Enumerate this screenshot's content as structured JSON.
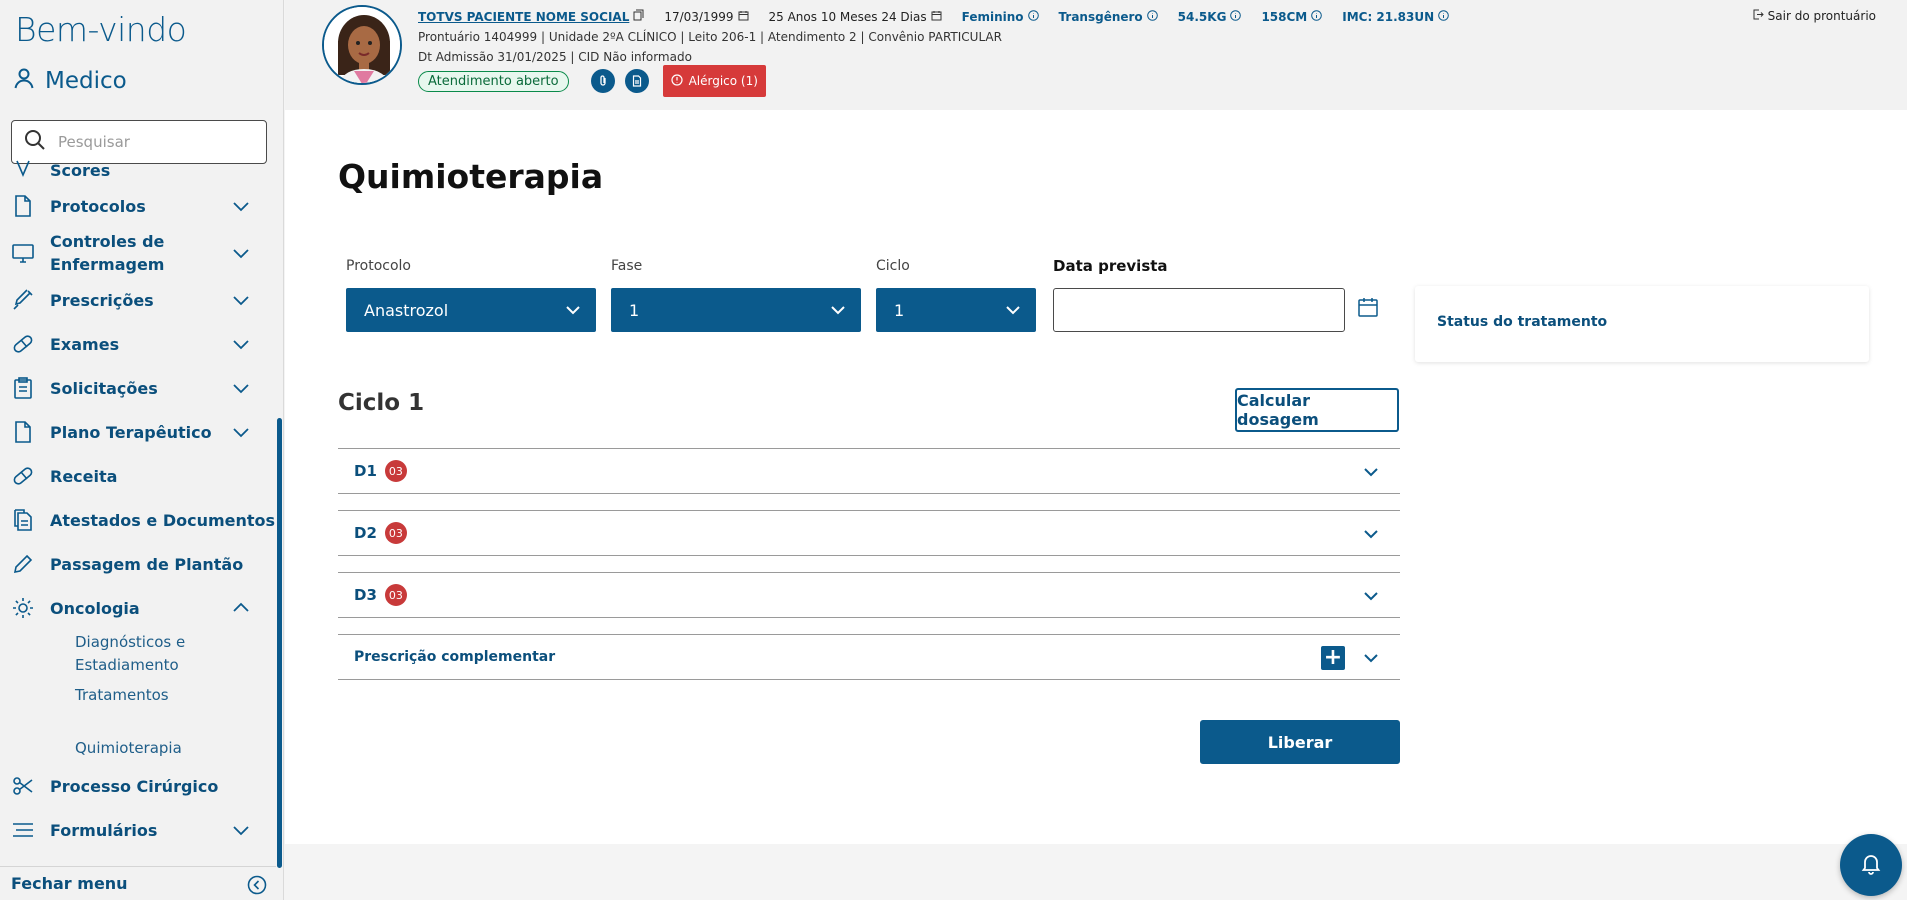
{
  "sidebar": {
    "welcome": "Bem-vindo",
    "user": "Medico",
    "search_placeholder": "Pesquisar",
    "items": [
      {
        "label": "Scores",
        "icon": "scores-icon",
        "expandable": false
      },
      {
        "label": "Protocolos",
        "icon": "document-icon",
        "expandable": true
      },
      {
        "label": "Controles de Enfermagem",
        "icon": "monitor-icon",
        "expandable": true
      },
      {
        "label": "Prescrições",
        "icon": "syringe-icon",
        "expandable": true
      },
      {
        "label": "Exames",
        "icon": "pill-icon",
        "expandable": true
      },
      {
        "label": "Solicitações",
        "icon": "clipboard-icon",
        "expandable": true
      },
      {
        "label": "Plano Terapêutico",
        "icon": "document-icon",
        "expandable": true
      },
      {
        "label": "Receita",
        "icon": "pill-icon",
        "expandable": false
      },
      {
        "label": "Atestados e Documentos",
        "icon": "documents-icon",
        "expandable": false
      },
      {
        "label": "Passagem de Plantão",
        "icon": "pencil-icon",
        "expandable": false
      },
      {
        "label": "Oncologia",
        "icon": "gear-icon",
        "expandable": true,
        "expanded": true
      },
      {
        "label": "Processo Cirúrgico",
        "icon": "scissors-icon",
        "expandable": false
      },
      {
        "label": "Formulários",
        "icon": "list-icon",
        "expandable": true
      }
    ],
    "oncologia_sub": [
      "Diagnósticos e Estadiamento",
      "Tratamentos",
      "Quimioterapia"
    ],
    "close_menu": "Fechar menu"
  },
  "patient": {
    "name": "TOTVS PACIENTE NOME SOCIAL",
    "birth": "17/03/1999",
    "age": "25 Anos 10 Meses 24 Dias",
    "sex": "Feminino",
    "gender": "Transgênero",
    "weight": "54.5KG",
    "height": "158CM",
    "imc": "IMC: 21.83UN",
    "line2": "Prontuário 1404999  |  Unidade 2ºA CLÍNICO  |  Leito 206-1  |  Atendimento 2  |  Convênio PARTICULAR",
    "line3": "Dt Admissão 31/01/2025  |  CID Não informado",
    "status_badge": "Atendimento aberto",
    "allergic": "Alérgico (1)",
    "exit": "Sair do prontuário"
  },
  "main": {
    "title": "Quimioterapia",
    "protocol_label": "Protocolo",
    "protocol_value": "Anastrozol",
    "phase_label": "Fase",
    "phase_value": "1",
    "cycle_label": "Ciclo",
    "cycle_value": "1",
    "date_label": "Data prevista",
    "date_value": "",
    "status_title": "Status do tratamento",
    "cycle_title": "Ciclo 1",
    "calc_button": "Calcular dosagem",
    "accordions": [
      {
        "label": "D1",
        "count": "03"
      },
      {
        "label": "D2",
        "count": "03"
      },
      {
        "label": "D3",
        "count": "03"
      }
    ],
    "complementary": "Prescrição complementar",
    "release_button": "Liberar"
  },
  "colors": {
    "primary": "#0b5a8c",
    "danger": "#d63a3a",
    "success": "#0a8a4a"
  }
}
